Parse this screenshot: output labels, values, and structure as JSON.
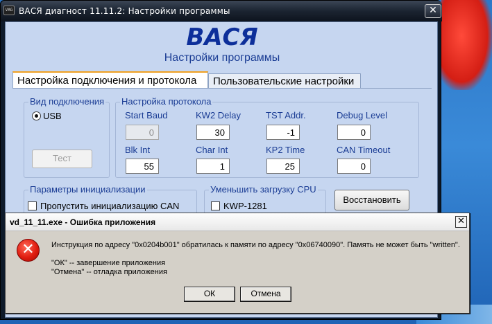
{
  "main_window": {
    "app_icon_label": "VAG",
    "title": "ВАСЯ диагност 11.11.2:  Настройки программы",
    "close_glyph": "✕",
    "brand": "ВАСЯ",
    "subtitle": "Настройки программы",
    "tabs": [
      {
        "label": "Настройка подключения и протокола",
        "active": true
      },
      {
        "label": "Пользовательские настройки",
        "active": false
      }
    ],
    "connection": {
      "group_label": "Вид подключения",
      "radio_label": "USB",
      "radio_selected": true,
      "test_button": "Тест"
    },
    "protocol": {
      "group_label": "Настройка протокола",
      "fields": [
        {
          "label": "Start Baud",
          "value": "0",
          "disabled": true
        },
        {
          "label": "KW2 Delay",
          "value": "30",
          "disabled": false
        },
        {
          "label": "TST Addr.",
          "value": "-1",
          "disabled": false
        },
        {
          "label": "Debug Level",
          "value": "0",
          "disabled": false
        },
        {
          "label": "Blk Int",
          "value": "55",
          "disabled": false
        },
        {
          "label": "Char Int",
          "value": "1",
          "disabled": false
        },
        {
          "label": "KP2 Time",
          "value": "25",
          "disabled": false
        },
        {
          "label": "CAN Timeout",
          "value": "0",
          "disabled": false
        }
      ]
    },
    "init": {
      "group_label": "Параметры инициализации",
      "checkbox_label": "Пропустить инициализацию CAN"
    },
    "cpu": {
      "group_label": "Уменьшить загрузку CPU",
      "checkbox_label": "KWP-1281"
    },
    "restore_button": "Восстановить"
  },
  "error_dialog": {
    "title": "vd_11_11.exe - Ошибка приложения",
    "close_glyph": "✕",
    "icon": "error-x-icon",
    "message": "Инструкция по адресу \"0x0204b001\" обратилась к памяти по адресу \"0x06740090\". Память не может быть \"written\".",
    "ok_hint": "\"ОК\" -- завершение приложения",
    "cancel_hint": "\"Отмена\" -- отладка приложения",
    "ok_button": "ОК",
    "cancel_button": "Отмена"
  },
  "colors": {
    "window_frame": "#0e1a2a",
    "client_bg": "#c6d6f0",
    "brand_blue": "#0d2f9a",
    "label_blue": "#1a3c94",
    "error_red": "#e01d10",
    "dialog_bg": "#d4d0c8",
    "desktop_blue": "#2d78c8"
  }
}
